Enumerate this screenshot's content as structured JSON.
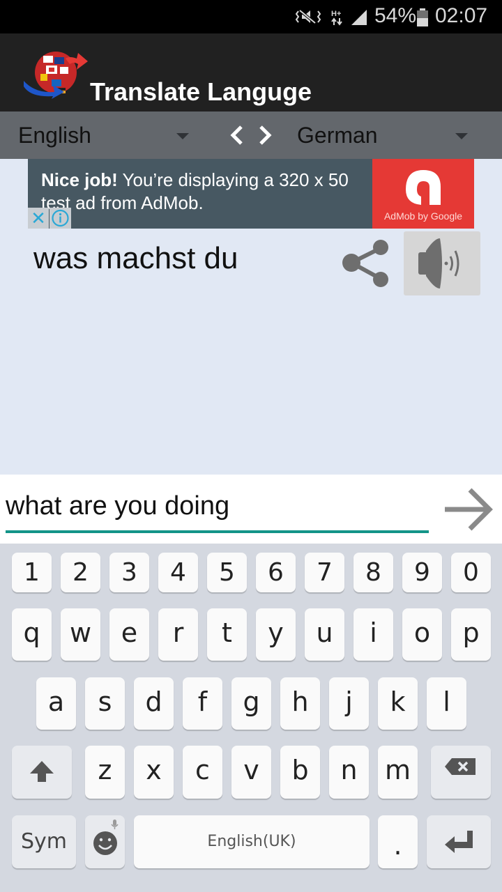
{
  "status_bar": {
    "icons": [
      "vibrate-mode-icon",
      "hplus-data-icon",
      "signal-icon",
      "battery-icon"
    ],
    "battery": "54%",
    "time": "02:07"
  },
  "app_bar": {
    "title": "Translate Languge",
    "logo": "globe-flags-logo"
  },
  "language_bar": {
    "source_language": "English",
    "target_language": "German",
    "swap_left": "‹",
    "swap_right": "›"
  },
  "ad_banner": {
    "bold_text": "Nice job!",
    "text": " You’re displaying a 320 x 50 test ad from AdMob.",
    "brand_caption": "AdMob by Google",
    "close_glyph": "✕",
    "colors": {
      "background": "#475862",
      "brand": "#e53935"
    }
  },
  "translation": {
    "output_text": "was machst du",
    "share_icon": "share-icon",
    "speak_icon": "speaker-icon"
  },
  "input": {
    "value": "what are you doing",
    "placeholder": "",
    "accent_color": "#139488"
  },
  "keyboard": {
    "number_row": [
      "1",
      "2",
      "3",
      "4",
      "5",
      "6",
      "7",
      "8",
      "9",
      "0"
    ],
    "row1": [
      "q",
      "w",
      "e",
      "r",
      "t",
      "y",
      "u",
      "i",
      "o",
      "p"
    ],
    "row2": [
      "a",
      "s",
      "d",
      "f",
      "g",
      "h",
      "j",
      "k",
      "l"
    ],
    "row3": [
      "z",
      "x",
      "c",
      "v",
      "b",
      "n",
      "m"
    ],
    "sym_label": "Sym",
    "space_label": "English(UK)",
    "period_label": "."
  }
}
